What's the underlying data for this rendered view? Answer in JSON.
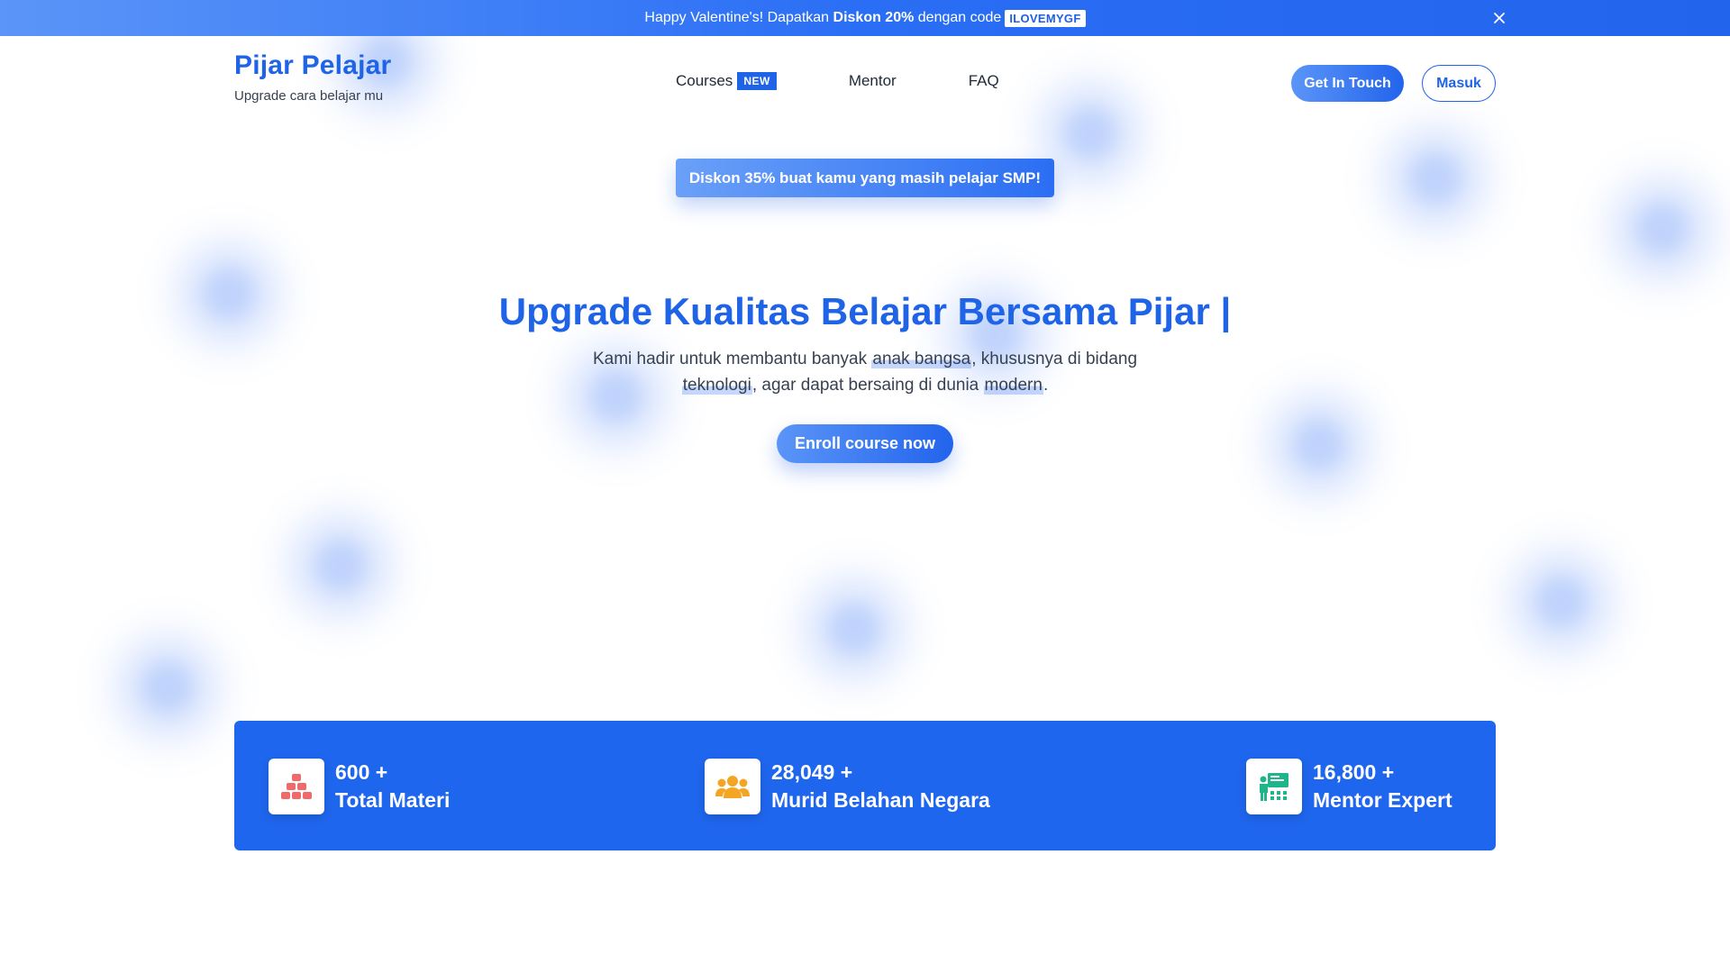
{
  "promo": {
    "text_before": "Happy Valentine's! Dapatkan ",
    "text_bold": "Diskon 20%",
    "text_after": " dengan code",
    "code": "ILOVEMYGF"
  },
  "brand": {
    "title": "Pijar Pelajar",
    "tagline": "Upgrade cara belajar mu"
  },
  "nav": {
    "courses": "Courses",
    "courses_badge": "NEW",
    "mentor": "Mentor",
    "faq": "FAQ"
  },
  "header_buttons": {
    "get_in_touch": "Get In Touch",
    "login": "Masuk"
  },
  "discount_pill": "Diskon 35% buat kamu yang masih pelajar SMP!",
  "hero": {
    "title": "Upgrade Kualitas Belajar Bersama Pijar |",
    "desc_1": "Kami hadir untuk membantu banyak ",
    "desc_hl_1": "anak bangsa",
    "desc_2": ", khususnya di bidang ",
    "desc_hl_2": "teknologi",
    "desc_3": ", agar dapat bersaing di dunia ",
    "desc_hl_3": "modern",
    "desc_4": ".",
    "cta": "Enroll course now"
  },
  "stats": [
    {
      "value": "600 +",
      "label": "Total Materi",
      "icon": "cubes-icon",
      "icon_color": "#f06a6a"
    },
    {
      "value": "28,049 +",
      "label": "Murid Belahan Negara",
      "icon": "users-icon",
      "icon_color": "#f5a524"
    },
    {
      "value": "16,800 +",
      "label": "Mentor Expert",
      "icon": "teacher-board-icon",
      "icon_color": "#1fb58a"
    }
  ],
  "colors": {
    "brand_blue": "#1f63e6",
    "stats_bg": "#1f66ee"
  }
}
